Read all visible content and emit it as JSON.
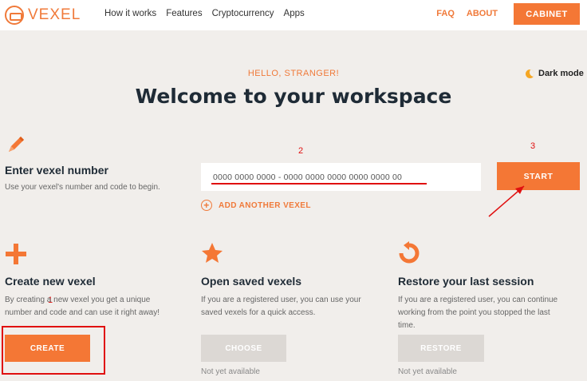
{
  "header": {
    "logo_text": "VEXEL",
    "nav": [
      "How it works",
      "Features",
      "Cryptocurrency",
      "Apps"
    ],
    "faq": "FAQ",
    "about": "ABOUT",
    "cabinet": "CABINET"
  },
  "hero": {
    "hello": "HELLO, STRANGER!",
    "title": "Welcome to your workspace",
    "dark_mode": "Dark mode"
  },
  "vexel": {
    "title": "Enter vexel number",
    "subtitle": "Use your vexel's number and code to begin.",
    "input_value": "0000 0000 0000 - 0000 0000 0000 0000 0000 00",
    "start": "START",
    "add_another": "ADD ANOTHER VEXEL"
  },
  "annotations": {
    "one": "1",
    "two": "2",
    "three": "3"
  },
  "columns": {
    "create": {
      "title": "Create new vexel",
      "desc": "By creating a new vexel you get a unique number and code and can use it right away!",
      "button": "CREATE"
    },
    "saved": {
      "title": "Open saved vexels",
      "desc": "If you are a registered user, you can use your saved vexels for a quick access.",
      "button": "CHOOSE",
      "note": "Not yet available"
    },
    "restore": {
      "title": "Restore your last session",
      "desc": "If you are a registered user, you can continue working from the point you stopped the last time.",
      "button": "RESTORE",
      "note": "Not yet available"
    }
  },
  "colors": {
    "accent": "#f47735",
    "annotation": "#e01010",
    "background": "#f1eeeb"
  },
  "icons": [
    "logo-icon",
    "moon-icon",
    "pencil-icon",
    "plus-circle-icon",
    "plus-icon",
    "star-icon",
    "restore-icon"
  ]
}
